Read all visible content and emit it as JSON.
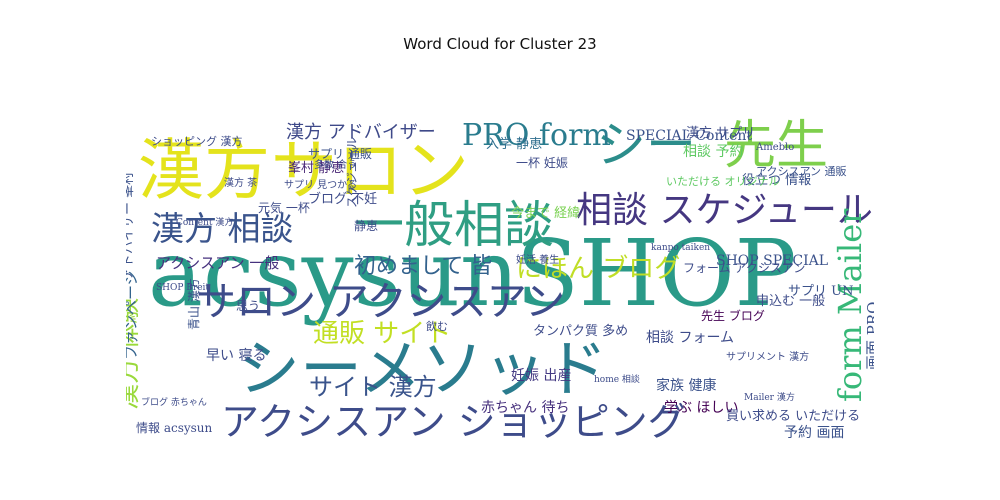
{
  "chart_data": {
    "type": "wordcloud",
    "title": "Word Cloud for Cluster 23",
    "words": [
      {
        "text": "acsysun",
        "color": "#2a9a88"
      },
      {
        "text": "SHOP",
        "color": "#2a9a88"
      },
      {
        "text": "漢方",
        "color": "#e4e31c"
      },
      {
        "text": "サロン",
        "color": "#e4e31c"
      },
      {
        "text": "シー",
        "color": "#2c8d8b"
      },
      {
        "text": "先生",
        "color": "#7ecf4c"
      },
      {
        "text": "シーメソッド",
        "color": "#2a7c8e"
      },
      {
        "text": "サロン アクシスアン",
        "color": "#3e4c8a"
      },
      {
        "text": "アクシスアン ショッピング",
        "color": "#3e4c8a"
      },
      {
        "text": "一般相談",
        "color": "#2f9e83"
      },
      {
        "text": "相談 スケジュール",
        "color": "#453781"
      },
      {
        "text": "漢方 相談",
        "color": "#3a548c"
      },
      {
        "text": "PRO form",
        "color": "#2a7c8e"
      },
      {
        "text": "form Mailer",
        "color": "#37b878"
      },
      {
        "text": "漢方 体験",
        "color": "#9ad93c"
      },
      {
        "text": "通販 サイト",
        "color": "#c2df23"
      },
      {
        "text": "にほん ブログ",
        "color": "#c0de26"
      },
      {
        "text": "初めまして 皆",
        "color": "#33628d"
      },
      {
        "text": "サイト 漢方",
        "color": "#3a548c"
      },
      {
        "text": "漢方 アドバイザー",
        "color": "#3e4989"
      },
      {
        "text": "アクシスアン 一般",
        "color": "#46317e"
      },
      {
        "text": "SHOP SPECIAL",
        "color": "#3b528b"
      },
      {
        "text": "SPECIAL Content",
        "color": "#3b528b"
      },
      {
        "text": "相談 予約",
        "color": "#5ec962"
      },
      {
        "text": "漢方 サプリ",
        "color": "#3e4c8a"
      },
      {
        "text": "役立つ 情報",
        "color": "#3b528b"
      },
      {
        "text": "予約 画面",
        "color": "#3b528b"
      },
      {
        "text": "妊娠 出産",
        "color": "#443a83"
      },
      {
        "text": "家族 健康",
        "color": "#3b528b"
      },
      {
        "text": "赤ちゃん 待ち",
        "color": "#46307d"
      },
      {
        "text": "相談 フォーム",
        "color": "#3e4c8a"
      },
      {
        "text": "サプリ UN",
        "color": "#3b528b"
      },
      {
        "text": "学ぶ ほしい",
        "color": "#440154"
      },
      {
        "text": "入学 静恵",
        "color": "#2e6e8e"
      },
      {
        "text": "一杯 妊娠",
        "color": "#3e4c8a"
      },
      {
        "text": "峯村 静恵",
        "color": "#482576"
      },
      {
        "text": "フォーム アクシスアン",
        "color": "#3e4c8a"
      },
      {
        "text": "元気 一杯",
        "color": "#3e4c8a"
      },
      {
        "text": "ブログ 不妊",
        "color": "#3e4c8a"
      },
      {
        "text": "サプリ 通販",
        "color": "#3b528b"
      },
      {
        "text": "アクシスアン 通販",
        "color": "#3b528b"
      },
      {
        "text": "画面 PRO",
        "color": "#3b528b"
      },
      {
        "text": "メソッド 初めまして",
        "color": "#8fd744"
      },
      {
        "text": "先生 ブログ",
        "color": "#440154"
      },
      {
        "text": "今まで 経緯",
        "color": "#7ad151"
      },
      {
        "text": "タンパク質 多め",
        "color": "#3e4c8a"
      },
      {
        "text": "ファンページ",
        "color": "#33638d"
      },
      {
        "text": "アドバイザー 峯村",
        "color": "#3b528b"
      },
      {
        "text": "スケジュール",
        "color": "#3e4c8a"
      },
      {
        "text": "早い 寝る",
        "color": "#3e4c8a"
      },
      {
        "text": "青山 漢方",
        "color": "#3b528b"
      },
      {
        "text": "情報 acsysun",
        "color": "#3e4c8a"
      },
      {
        "text": "ショッピング 漢方",
        "color": "#3e4c8a"
      },
      {
        "text": "サプリ 見つかる",
        "color": "#3e4c8a"
      },
      {
        "text": "多数 合う",
        "color": "#3e4c8a"
      },
      {
        "text": "漢方 茶",
        "color": "#3e4c8a"
      },
      {
        "text": "申込む 一般",
        "color": "#3e4c8a"
      },
      {
        "text": "買い求める いただける",
        "color": "#3e4c8a"
      },
      {
        "text": "妊活 養生",
        "color": "#3e4c8a"
      },
      {
        "text": "静恵",
        "color": "#3e4c8a"
      },
      {
        "text": "思う",
        "color": "#3e4c8a"
      },
      {
        "text": "飲む",
        "color": "#3e4c8a"
      },
      {
        "text": "Ameblo",
        "color": "#3e4c8a"
      },
      {
        "text": "いただける オリジナル",
        "color": "#5ec962"
      },
      {
        "text": "サプリメント 漢方",
        "color": "#3e4c8a"
      },
      {
        "text": "ブログ 赤ちゃん",
        "color": "#3e4c8a"
      },
      {
        "text": "Content 漢方",
        "color": "#3e4c8a"
      },
      {
        "text": "Mailer 漢方",
        "color": "#3e4c8a"
      },
      {
        "text": "home 相談",
        "color": "#3e4c8a"
      },
      {
        "text": "SHOP Breit",
        "color": "#3e4c8a"
      },
      {
        "text": "kanpo taiken",
        "color": "#3e4c8a"
      }
    ]
  }
}
